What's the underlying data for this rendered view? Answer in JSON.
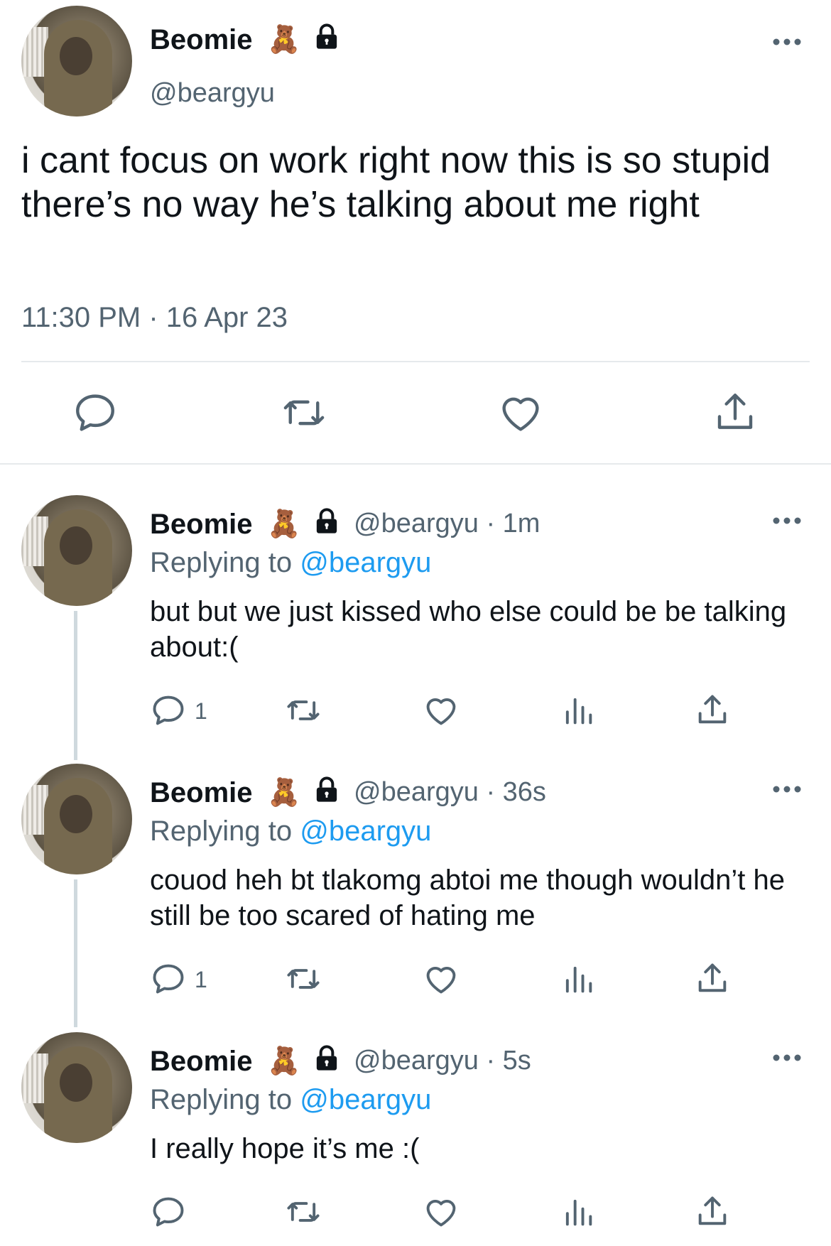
{
  "main_tweet": {
    "display_name": "Beomie",
    "name_emoji": "🧸",
    "handle": "@beargyu",
    "text": "i cant focus on work right now this is so stupid there’s no way he’s talking about me right",
    "timestamp": "11:30 PM · 16 Apr 23"
  },
  "replies": [
    {
      "display_name": "Beomie",
      "name_emoji": "🧸",
      "handle_time": "@beargyu · 1m",
      "replying_prefix": "Replying to ",
      "replying_mention": "@beargyu",
      "text": "but but we just kissed who else could be be talking about:(",
      "reply_count": "1"
    },
    {
      "display_name": "Beomie",
      "name_emoji": "🧸",
      "handle_time": "@beargyu · 36s",
      "replying_prefix": "Replying to ",
      "replying_mention": "@beargyu",
      "text": "couod heh bt tlakomg abtoi me though wouldn’t he still be too scared of hating me",
      "reply_count": "1"
    },
    {
      "display_name": "Beomie",
      "name_emoji": "🧸",
      "handle_time": "@beargyu · 5s",
      "replying_prefix": "Replying to ",
      "replying_mention": "@beargyu",
      "text": "I really hope it’s me :(",
      "reply_count": ""
    }
  ],
  "icons": {
    "reply": "speech-bubble-icon",
    "retweet": "retweet-icon",
    "like": "heart-icon",
    "views": "bar-chart-icon",
    "share": "share-icon",
    "more": "ellipsis-icon",
    "protected": "lock-icon"
  },
  "colors": {
    "text": "#0f1419",
    "secondary": "#536471",
    "link": "#1d9bf0",
    "divider": "#e6e9ec"
  }
}
